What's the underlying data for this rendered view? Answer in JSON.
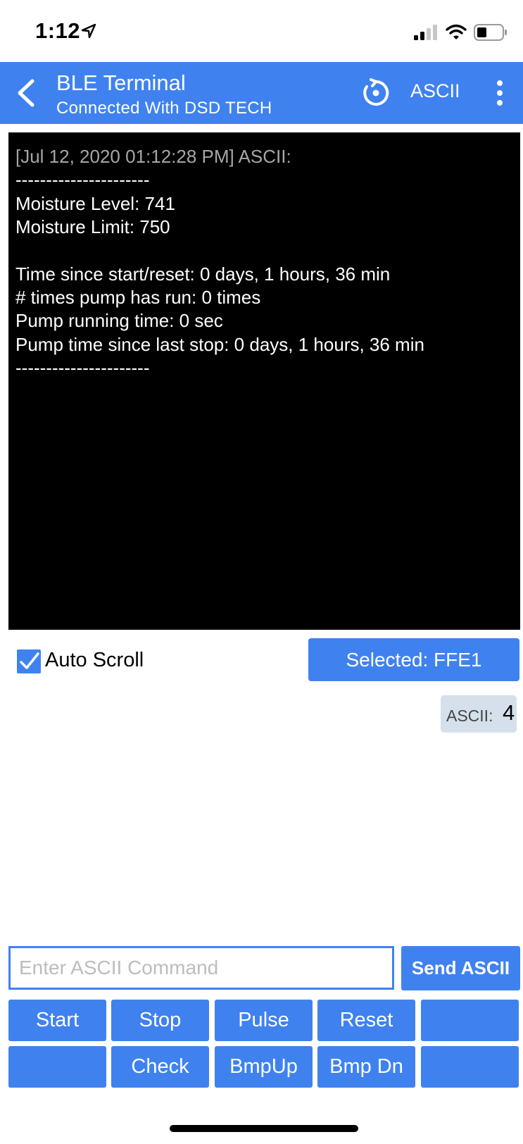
{
  "status_bar": {
    "time": "1:12"
  },
  "nav": {
    "title": "BLE Terminal",
    "subtitle": "Connected With DSD TECH",
    "mode_label": "ASCII"
  },
  "terminal": {
    "header": "[Jul 12, 2020 01:12:28 PM] ASCII:",
    "lines": [
      "----------------------",
      "Moisture Level: 741",
      "Moisture Limit: 750",
      "",
      "Time since start/reset: 0 days, 1 hours, 36 min",
      "# times pump has run: 0 times",
      "Pump running time: 0 sec",
      "Pump time since last stop: 0 days, 1 hours, 36 min",
      "----------------------"
    ]
  },
  "controls": {
    "auto_scroll_label": "Auto Scroll",
    "auto_scroll_checked": true,
    "selected_label": "Selected: FFE1",
    "counter_label": "ASCII:",
    "counter_value": "4"
  },
  "input": {
    "placeholder": "Enter ASCII Command",
    "value": "",
    "send_label": "Send ASCII"
  },
  "macros": {
    "row1": [
      "Start",
      "Stop",
      "Pulse",
      "Reset",
      ""
    ],
    "row2": [
      "",
      "Check",
      "BmpUp",
      "Bmp Dn",
      ""
    ]
  },
  "colors": {
    "accent": "#3f82ef",
    "terminal_bg": "#000000"
  }
}
